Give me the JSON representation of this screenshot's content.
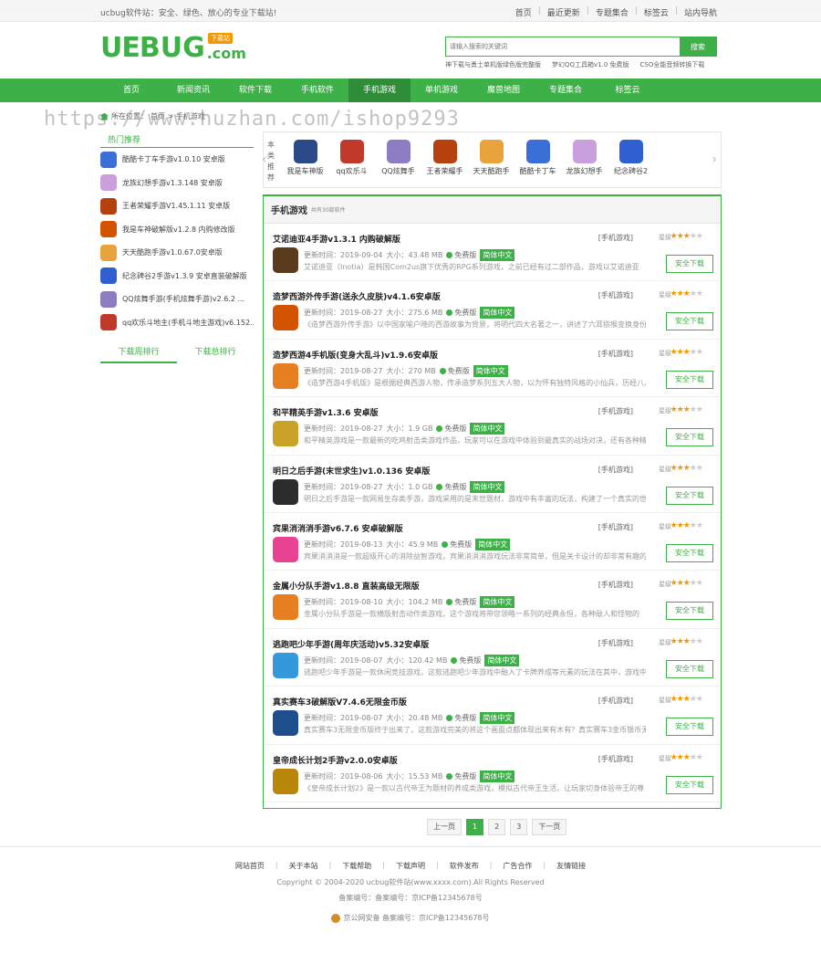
{
  "topbar": {
    "welcome": "ucbug软件站：安全、绿色、放心的专业下载站!",
    "links": [
      "首页",
      "最近更新",
      "专题集合",
      "标签云",
      "站内导航"
    ]
  },
  "logo": {
    "ue": "UE",
    "bug": "BUG",
    "com": ".com",
    "tag": "下载站"
  },
  "search": {
    "placeholder": "请输入搜索的关键词",
    "button": "搜索",
    "hotwords": [
      "神下载与勇士单机版绿色版完整版",
      "梦幻QQ工具箱v1.0 免费版",
      "CSO全能音频转换下载"
    ]
  },
  "nav": [
    "首页",
    "新闻资讯",
    "软件下载",
    "手机软件",
    "手机游戏",
    "单机游戏",
    "魔兽地图",
    "专题集合",
    "标签云"
  ],
  "watermark": "https://www.huzhan.com/ishop9293",
  "breadcrumb": {
    "home": "所在位置：",
    "path": "首页 > 手机游戏"
  },
  "sidebar": {
    "title": "热门推荐",
    "items": [
      "酷酷卡丁车手游v1.0.10 安卓版",
      "龙族幻想手游v1.3.148 安卓版",
      "王者荣耀手游V1.45.1.11 安卓版",
      "我是车神破解版v1.2.8 内购修改版",
      "天天酷跑手游v1.0.67.0安卓版",
      "纪念碑谷2手游v1.3.9 安卓直装破解版",
      "QQ炫舞手游(手机炫舞手游)v2.6.2 ...",
      "qq欢乐斗地主(手机斗地主游戏)v6.152...."
    ],
    "tabs": [
      "下载周排行",
      "下载总排行"
    ]
  },
  "carousel": {
    "label": [
      "本",
      "类",
      "推",
      "荐"
    ],
    "items": [
      "我是车神版",
      "qq欢乐斗",
      "QQ炫舞手",
      "王者荣耀手",
      "天天酷跑手",
      "酷酷卡丁车",
      "龙族幻想手",
      "纪念碑谷2"
    ],
    "colors": [
      "#2b4a8a",
      "#c0392b",
      "#8e7cc3",
      "#b7410e",
      "#e8a33d",
      "#3a6fd8",
      "#c9a0dc",
      "#2f5fd0"
    ]
  },
  "list": {
    "title": "手机游戏",
    "count": "共有30款软件",
    "games": [
      {
        "name": "艾诺迪亚4手游v1.3.1 内购破解版",
        "cat": "[手机游戏]",
        "lv": "星级",
        "date": "更新时间：2019-09-04",
        "size": "大小：43.48 MB",
        "free": "免费版",
        "lang": "简体中文",
        "desc": "艾诺迪亚（Inotia）是韩国Com2us旗下优秀的RPG系列游戏，之前已经有过二部作品，游戏以艾诺迪亚",
        "dl": "安全下载",
        "color": "#5a3b1e",
        "stars": 3
      },
      {
        "name": "造梦西游外传手游(送永久皮肤)v4.1.6安卓版",
        "cat": "[手机游戏]",
        "lv": "星级",
        "date": "更新时间：2019-08-27",
        "size": "大小：275.6 MB",
        "free": "免费版",
        "lang": "简体中文",
        "desc": "《造梦西游外传手游》以中国家喻户晓的西游故事为背景，将明代四大名著之一，讲述了六耳猕猴变换身份，怪空",
        "dl": "安全下载",
        "color": "#d35400",
        "stars": 3
      },
      {
        "name": "造梦西游4手机版(变身大乱斗)v1.9.6安卓版",
        "cat": "[手机游戏]",
        "lv": "星级",
        "date": "更新时间：2019-08-27",
        "size": "大小：270 MB",
        "free": "免费版",
        "lang": "简体中文",
        "desc": "《造梦西游4手机版》是根据经典西游人物，传承造梦系列五大人物，以为怀有独特风格的小仙兵，历经八八",
        "dl": "安全下载",
        "color": "#e67e22",
        "stars": 3
      },
      {
        "name": "和平精英手游v1.3.6 安卓版",
        "cat": "[手机游戏]",
        "lv": "星级",
        "date": "更新时间：2019-08-27",
        "size": "大小：1.9 GB",
        "free": "免费版",
        "lang": "简体中文",
        "desc": "和平精英游戏是一款最新的吃鸡射击类游戏作品，玩家可以在游戏中体验到最真实的战场对决，还有各种精彩玩法",
        "dl": "安全下载",
        "color": "#c9a227",
        "stars": 3
      },
      {
        "name": "明日之后手游(末世求生)v1.0.136 安卓版",
        "cat": "[手机游戏]",
        "lv": "星级",
        "date": "更新时间：2019-08-27",
        "size": "大小：1.0 GB",
        "free": "免费版",
        "lang": "简体中文",
        "desc": "明日之后手游是一款网易生存类手游，游戏采用的是末世题材，游戏中有丰富的玩法，构建了一个真实的世界",
        "dl": "安全下载",
        "color": "#2c2c2c",
        "stars": 3
      },
      {
        "name": "宾果消消消手游v6.7.6 安卓破解版",
        "cat": "[手机游戏]",
        "lv": "星级",
        "date": "更新时间：2019-08-13",
        "size": "大小：45.9 MB",
        "free": "免费版",
        "lang": "简体中文",
        "desc": "宾果消消消是一款超级开心的消除益智游戏，宾果消消消游戏玩法非常简单，但是关卡设计的却非常有趣的",
        "dl": "安全下载",
        "color": "#e84393",
        "stars": 3
      },
      {
        "name": "金属小分队手游v1.8.8 直装高级无限版",
        "cat": "[手机游戏]",
        "lv": "星级",
        "date": "更新时间：2019-08-10",
        "size": "大小：104.2 MB",
        "free": "免费版",
        "lang": "简体中文",
        "desc": "金属小分队手游是一款横版射击动作类游戏，这个游戏将带您领略一系列的经典永恒，各种敌人和怪物的",
        "dl": "安全下载",
        "color": "#e67e22",
        "stars": 3
      },
      {
        "name": "逃跑吧少年手游(周年庆活动)v5.32安卓版",
        "cat": "[手机游戏]",
        "lv": "星级",
        "date": "更新时间：2019-08-07",
        "size": "大小：120.42 MB",
        "free": "免费版",
        "lang": "简体中文",
        "desc": "逃跑吧少年手游是一款休闲竞技游戏，这款逃跑吧少年游戏中融入了卡牌养成等元素的玩法在其中，游戏中每",
        "dl": "安全下载",
        "color": "#3498db",
        "stars": 3
      },
      {
        "name": "真实赛车3破解版V7.4.6无限金币版",
        "cat": "[手机游戏]",
        "lv": "星级",
        "date": "更新时间：2019-08-07",
        "size": "大小：20.48 MB",
        "free": "免费版",
        "lang": "简体中文",
        "desc": "真实赛车3无限金币版终于出来了，这款游戏完美的将这个画面点都体现出来有木有？真实赛车3金币银币无限版",
        "dl": "安全下载",
        "color": "#1f4e8c",
        "stars": 3
      },
      {
        "name": "皇帝成长计划2手游v2.0.0安卓版",
        "cat": "[手机游戏]",
        "lv": "星级",
        "date": "更新时间：2019-08-06",
        "size": "大小：15.53 MB",
        "free": "免费版",
        "lang": "简体中文",
        "desc": "《皇帝成长计划2》是一款以古代帝王为题材的养成类游戏，模拟古代帝王生活，让玩家切身体验帝王的尊",
        "dl": "安全下载",
        "color": "#b8860b",
        "stars": 3
      }
    ]
  },
  "pager": [
    "上一页",
    "1",
    "2",
    "3",
    "下一页"
  ],
  "footer": {
    "links": [
      "网站首页",
      "关于本站",
      "下载帮助",
      "下载声明",
      "软件发布",
      "广告合作",
      "友情链接"
    ],
    "copyright": "Copyright © 2004-2020 ucbug软件站(www.xxxx.com).All Rights Reserved",
    "icp": "备案编号：备案编号：京ICP备12345678号",
    "police": "京公网安备 备案编号：京ICP备12345678号"
  }
}
